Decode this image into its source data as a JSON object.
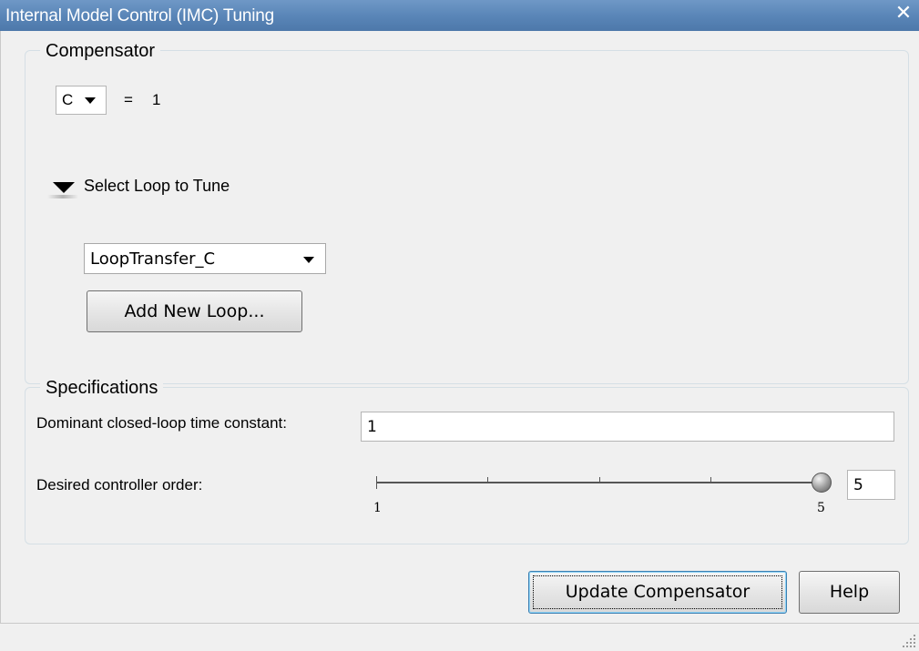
{
  "window": {
    "title": "Internal Model Control (IMC) Tuning"
  },
  "compensator": {
    "group_label": "Compensator",
    "selected": "C",
    "equals": "=",
    "value": "1",
    "loop_toggle_label": "Select Loop to Tune",
    "loop_selected": "LoopTransfer_C",
    "add_loop_label": "Add New Loop..."
  },
  "specifications": {
    "group_label": "Specifications",
    "time_constant_label": "Dominant closed-loop time constant:",
    "time_constant_value": "1",
    "order_label": "Desired controller order:",
    "order_value": "5",
    "order_slider": {
      "min": 1,
      "max": 5,
      "value": 5,
      "min_label": "1",
      "max_label": "5"
    }
  },
  "actions": {
    "update_label": "Update Compensator",
    "help_label": "Help"
  },
  "colors": {
    "titlebar": "#5a86b8",
    "background": "#f0f0f0",
    "group_border": "#d5dfe5"
  },
  "icons": [
    "close-icon",
    "chevron-down-icon",
    "expand-triangle-icon",
    "resize-grip-icon"
  ]
}
